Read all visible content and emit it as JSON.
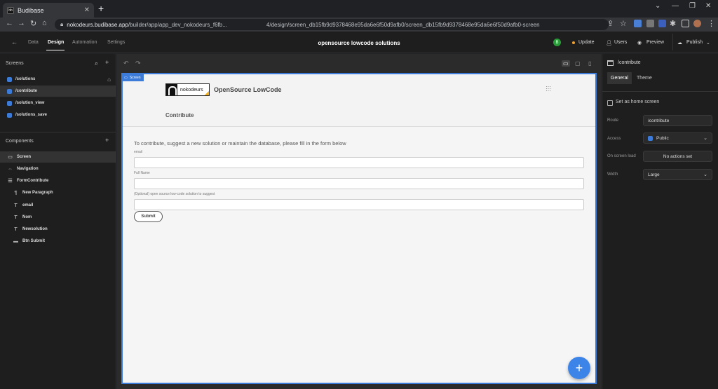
{
  "browser": {
    "tab_title": "Budibase",
    "tab_close": "✕",
    "new_tab": "+",
    "url_host": "nokodeurs.budibase.app",
    "url_path_a": "/builder/app/app_dev_nokodeurs_f6fb...",
    "url_path_b": "4/design/screen_db15fb9d9378468e95da6e6f50d9afb0/screen_db15fb9d9378468e95da6e6f50d9afb0-screen"
  },
  "topnav": {
    "back": "←",
    "items": [
      "Data",
      "Design",
      "Automation",
      "Settings"
    ],
    "active": "Design",
    "app_title": "opensource lowcode solutions",
    "avatar_letter": "B",
    "update": "Update",
    "users": "Users",
    "preview": "Preview",
    "publish": "Publish"
  },
  "left": {
    "screens_header": "Screens",
    "screens": [
      "/solutions",
      "/contribute",
      "/solution_view",
      "/solutions_save"
    ],
    "selected_screen": "/contribute",
    "components_header": "Components",
    "components": [
      {
        "label": "Screen",
        "icon": "▭",
        "indent": 0
      },
      {
        "label": "Navigation",
        "icon": "⇔",
        "indent": 0
      },
      {
        "label": "FormContribute",
        "icon": "☰",
        "indent": 0
      },
      {
        "label": "New Paragraph",
        "icon": "¶",
        "indent": 1
      },
      {
        "label": "email",
        "icon": "T",
        "indent": 1
      },
      {
        "label": "Nom",
        "icon": "T",
        "indent": 1
      },
      {
        "label": "Newsolution",
        "icon": "T",
        "indent": 1
      },
      {
        "label": "Btn Submit",
        "icon": "▬",
        "indent": 1
      }
    ]
  },
  "canvas": {
    "badge": "Screen",
    "logo_text": "nokodeurs",
    "app_name": "OpenSource LowCode",
    "nav_link": "Contribute",
    "paragraph": "To contribute, suggest a new solution or maintain the database, please fill in the form below",
    "fields": [
      {
        "label": "email",
        "value": ""
      },
      {
        "label": "Full Name",
        "value": ""
      },
      {
        "label": "(Optional) open source low-code solution to suggest",
        "value": ""
      }
    ],
    "submit": "Submit",
    "fab": "+"
  },
  "right": {
    "title": "/contribute",
    "tabs": [
      "General",
      "Theme"
    ],
    "selected_tab": "General",
    "home_checkbox": "Set as home screen",
    "route_label": "Route",
    "route_value": "/contribute",
    "access_label": "Access",
    "access_value": "Public",
    "onload_label": "On screen load",
    "onload_value": "No actions set",
    "width_label": "Width",
    "width_value": "Large"
  },
  "colors": {
    "accent": "#3d7bd9",
    "fab": "#3d84e8",
    "panel": "#1e1e1e",
    "canvas_bg": "#f5f5f5"
  }
}
